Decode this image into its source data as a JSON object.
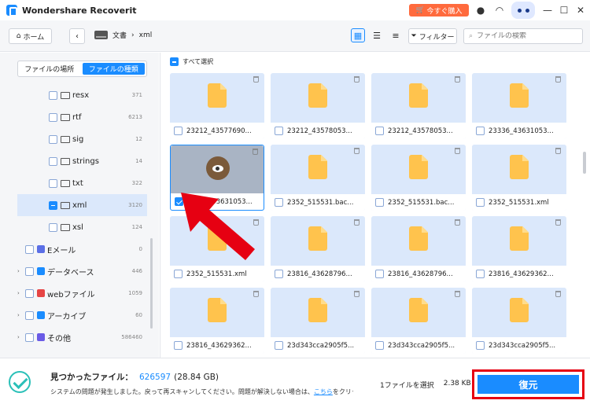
{
  "titlebar": {
    "app_name": "Wondershare Recoverit",
    "buy_label": "今すぐ購入"
  },
  "toolbar": {
    "home_label": "ホーム",
    "breadcrumb": [
      "文書",
      "xml"
    ],
    "filter_label": "フィルター",
    "search_placeholder": "ファイルの検索"
  },
  "sidebar": {
    "tabs": [
      {
        "label": "ファイルの場所",
        "active": false
      },
      {
        "label": "ファイルの種類",
        "active": true
      }
    ],
    "items": [
      {
        "label": "resx",
        "count": "371"
      },
      {
        "label": "rtf",
        "count": "6213"
      },
      {
        "label": "sig",
        "count": "12"
      },
      {
        "label": "strings",
        "count": "14"
      },
      {
        "label": "txt",
        "count": "322"
      },
      {
        "label": "xml",
        "count": "3120",
        "selected": true
      },
      {
        "label": "xsl",
        "count": "124"
      }
    ],
    "categories": [
      {
        "label": "Eメール",
        "count": "0",
        "color": "#5b6fe6",
        "icon": "email-icon"
      },
      {
        "label": "データベース",
        "count": "446",
        "color": "#1a8cff",
        "icon": "database-icon"
      },
      {
        "label": "webファイル",
        "count": "1059",
        "color": "#e64545",
        "icon": "web-icon"
      },
      {
        "label": "アーカイブ",
        "count": "60",
        "color": "#1a8cff",
        "icon": "archive-icon"
      },
      {
        "label": "その他",
        "count": "586460",
        "color": "#6a5be6",
        "icon": "other-icon"
      }
    ]
  },
  "content": {
    "select_all_label": "すべて選択",
    "files": [
      {
        "name": "23212_43577690...",
        "checked": false,
        "thumb": "file"
      },
      {
        "name": "23212_43578053...",
        "checked": false,
        "thumb": "file"
      },
      {
        "name": "23212_43578053...",
        "checked": false,
        "thumb": "file"
      },
      {
        "name": "23336_43631053...",
        "checked": false,
        "thumb": "file"
      },
      {
        "name": "23336_43631053...",
        "checked": true,
        "thumb": "preview"
      },
      {
        "name": "2352_515531.bac...",
        "checked": false,
        "thumb": "file"
      },
      {
        "name": "2352_515531.bac...",
        "checked": false,
        "thumb": "file"
      },
      {
        "name": "2352_515531.xml",
        "checked": false,
        "thumb": "file"
      },
      {
        "name": "2352_515531.xml",
        "checked": false,
        "thumb": "file"
      },
      {
        "name": "23816_43628796...",
        "checked": false,
        "thumb": "file"
      },
      {
        "name": "23816_43628796...",
        "checked": false,
        "thumb": "file"
      },
      {
        "name": "23816_43629362...",
        "checked": false,
        "thumb": "file"
      },
      {
        "name": "23816_43629362...",
        "checked": false,
        "thumb": "file"
      },
      {
        "name": "23d343cca2905f5...",
        "checked": false,
        "thumb": "file"
      },
      {
        "name": "23d343cca2905f5...",
        "checked": false,
        "thumb": "file"
      },
      {
        "name": "23d343cca2905f5...",
        "checked": false,
        "thumb": "file"
      }
    ]
  },
  "footer": {
    "found_label": "見つかったファイル：",
    "found_count": "626597",
    "found_size": "(28.84 GB)",
    "message_prefix": "システムの問題が発生しました。戻って再スキャンしてください。問題が解決しない場合は、",
    "message_link": "こちら",
    "message_suffix": "をクリックして",
    "selected_label": "1ファイルを選択",
    "selected_size": "2.38 KB",
    "recover_label": "復元"
  },
  "colors": {
    "accent": "#1a8cff",
    "highlight": "#e60012",
    "file_icon": "#ffc34d"
  }
}
